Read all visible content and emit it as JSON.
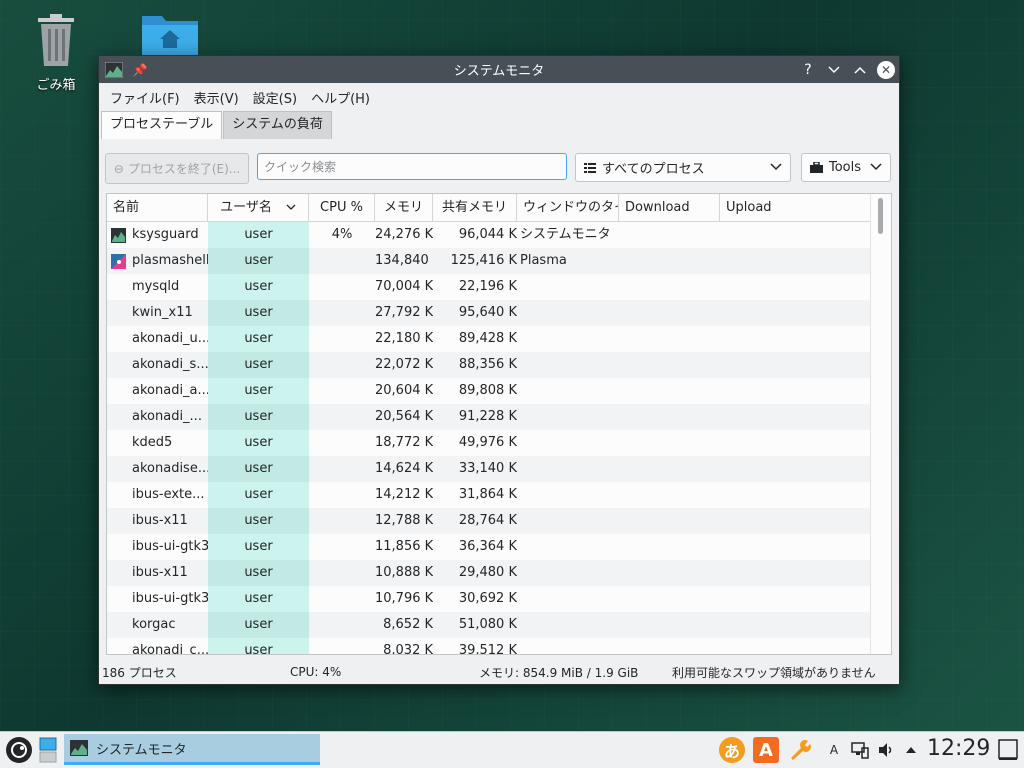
{
  "desktop": {
    "trash_label": "ごみ箱"
  },
  "window": {
    "title": "システムモニタ"
  },
  "menu": [
    "ファイル(F)",
    "表示(V)",
    "設定(S)",
    "ヘルプ(H)"
  ],
  "tabs": [
    "プロセステーブル",
    "システムの負荷"
  ],
  "toolbar": {
    "end_process_label": "プロセスを終了(E)...",
    "search_placeholder": "クイック検索",
    "process_filter": "すべてのプロセス",
    "tools_label": "Tools"
  },
  "table": {
    "columns": [
      "名前",
      "ユーザ名",
      "CPU %",
      "メモリ",
      "共有メモリ",
      "ウィンドウのタイト",
      "Download",
      "Upload"
    ],
    "rows": [
      {
        "name": "ksysguard",
        "user": "user",
        "cpu": "4%",
        "mem": "24,276 K",
        "shared": "96,044 K",
        "window": "システムモニタ",
        "icon": "ksysguard"
      },
      {
        "name": "plasmashell",
        "user": "user",
        "cpu": "",
        "mem": "134,840 K",
        "shared": "125,416 K",
        "window": "Plasma",
        "icon": "plasma"
      },
      {
        "name": "mysqld",
        "user": "user",
        "cpu": "",
        "mem": "70,004 K",
        "shared": "22,196 K",
        "window": "",
        "icon": ""
      },
      {
        "name": "kwin_x11",
        "user": "user",
        "cpu": "",
        "mem": "27,792 K",
        "shared": "95,640 K",
        "window": "",
        "icon": ""
      },
      {
        "name": "akonadi_u...",
        "user": "user",
        "cpu": "",
        "mem": "22,180 K",
        "shared": "89,428 K",
        "window": "",
        "icon": ""
      },
      {
        "name": "akonadi_s...",
        "user": "user",
        "cpu": "",
        "mem": "22,072 K",
        "shared": "88,356 K",
        "window": "",
        "icon": ""
      },
      {
        "name": "akonadi_a...",
        "user": "user",
        "cpu": "",
        "mem": "20,604 K",
        "shared": "89,808 K",
        "window": "",
        "icon": ""
      },
      {
        "name": "akonadi_...",
        "user": "user",
        "cpu": "",
        "mem": "20,564 K",
        "shared": "91,228 K",
        "window": "",
        "icon": ""
      },
      {
        "name": "kded5",
        "user": "user",
        "cpu": "",
        "mem": "18,772 K",
        "shared": "49,976 K",
        "window": "",
        "icon": ""
      },
      {
        "name": "akonadise...",
        "user": "user",
        "cpu": "",
        "mem": "14,624 K",
        "shared": "33,140 K",
        "window": "",
        "icon": ""
      },
      {
        "name": "ibus-exte...",
        "user": "user",
        "cpu": "",
        "mem": "14,212 K",
        "shared": "31,864 K",
        "window": "",
        "icon": ""
      },
      {
        "name": "ibus-x11",
        "user": "user",
        "cpu": "",
        "mem": "12,788 K",
        "shared": "28,764 K",
        "window": "",
        "icon": ""
      },
      {
        "name": "ibus-ui-gtk3",
        "user": "user",
        "cpu": "",
        "mem": "11,856 K",
        "shared": "36,364 K",
        "window": "",
        "icon": ""
      },
      {
        "name": "ibus-x11",
        "user": "user",
        "cpu": "",
        "mem": "10,888 K",
        "shared": "29,480 K",
        "window": "",
        "icon": ""
      },
      {
        "name": "ibus-ui-gtk3",
        "user": "user",
        "cpu": "",
        "mem": "10,796 K",
        "shared": "30,692 K",
        "window": "",
        "icon": ""
      },
      {
        "name": "korgac",
        "user": "user",
        "cpu": "",
        "mem": "8,652 K",
        "shared": "51,080 K",
        "window": "",
        "icon": ""
      },
      {
        "name": "akonadi_c...",
        "user": "user",
        "cpu": "",
        "mem": "8,032 K",
        "shared": "39,512 K",
        "window": "",
        "icon": ""
      }
    ]
  },
  "status": {
    "process_count": "186 プロセス",
    "cpu": "CPU: 4%",
    "memory": "メモリ: 854.9 MiB / 1.9 GiB",
    "swap": "利用可能なスワップ領域がありません"
  },
  "taskbar": {
    "task_label": "システムモニタ",
    "clock": "12:29",
    "ime_label": "あ",
    "input_label": "A",
    "kbd_label": "A"
  },
  "colors": {
    "accent": "#3daee9",
    "titlebar": "#475057",
    "user_column": "#cdf3ee"
  }
}
